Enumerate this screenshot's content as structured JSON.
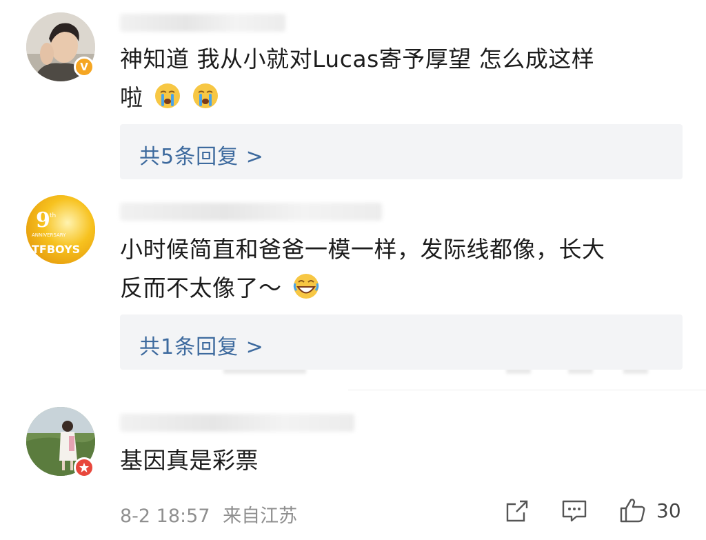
{
  "comments": [
    {
      "text_line1": "神知道 我从小就对Lucas寄予厚望  怎么成这样",
      "text_line2": "啦",
      "emojis": [
        "crying-face",
        "crying-face"
      ],
      "badge": "V",
      "replies": "共5条回复 >"
    },
    {
      "avatar_lines": [
        "9",
        "th",
        "ANNIVERSARY",
        "TFBOYS"
      ],
      "text_line1": "小时候简直和爸爸一模一样，发际线都像，长大",
      "text_line2": "反而不太像了～",
      "emojis": [
        "laughing-face"
      ],
      "replies": "共1条回复 >"
    },
    {
      "text_line1": "基因真是彩票",
      "timestamp": "8-2 18:57",
      "location": "来自江苏",
      "like_count": "30"
    }
  ],
  "colors": {
    "reply_link": "#3d6a9e",
    "reply_bg": "#f3f4f6",
    "verified_badge": "#f5a623",
    "star_badge": "#e8473c"
  }
}
